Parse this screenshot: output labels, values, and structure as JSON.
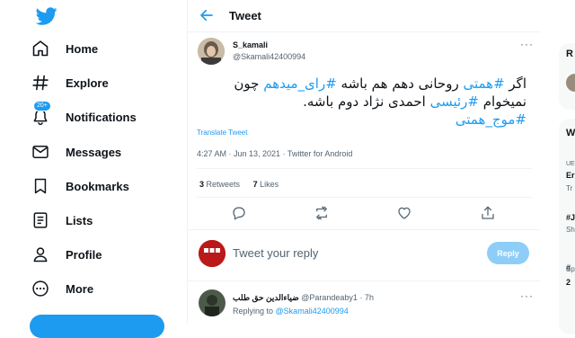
{
  "nav": {
    "items": [
      {
        "label": "Home",
        "icon": "home-icon"
      },
      {
        "label": "Explore",
        "icon": "hashtag-icon"
      },
      {
        "label": "Notifications",
        "icon": "bell-icon",
        "badge": "20+"
      },
      {
        "label": "Messages",
        "icon": "envelope-icon"
      },
      {
        "label": "Bookmarks",
        "icon": "bookmark-icon"
      },
      {
        "label": "Lists",
        "icon": "list-icon"
      },
      {
        "label": "Profile",
        "icon": "person-icon"
      },
      {
        "label": "More",
        "icon": "more-circle-icon"
      }
    ]
  },
  "header": {
    "title": "Tweet"
  },
  "tweet": {
    "display_name": "S_kamali",
    "handle": "@Skamali42400994",
    "text": {
      "line1_pre": "اگر ",
      "tag1": "#همتی",
      "line1_mid": " روحانی دهم هم باشه ",
      "tag2": "#رای_میدهم",
      "line1_post": " چون",
      "line2_pre": "نمیخوام ",
      "tag3": "#رئیسی",
      "line2_post": " احمدی نژاد دوم باشه.",
      "tag4": "#موج_همتی"
    },
    "translate_label": "Translate Tweet",
    "timestamp": "4:27 AM · Jun 13, 2021 · Twitter for Android",
    "retweets_count": "3",
    "retweets_label": "Retweets",
    "likes_count": "7",
    "likes_label": "Likes"
  },
  "reply_box": {
    "placeholder": "Tweet your reply",
    "button_label": "Reply",
    "avatar_text": "BBC NEWS"
  },
  "reply": {
    "display_name": "ضیاءالدین حق طلب",
    "handle": "@Parandeaby1",
    "time": "· 7h",
    "replying_to_label": "Replying to",
    "replying_to_handle": "@Skamali42400994"
  },
  "right": {
    "card1_initial": "R",
    "card2_initial": "W",
    "snippets": [
      "UE",
      "Er",
      "Tr",
      "#J",
      "Sh",
      "#",
      "Sp",
      "2"
    ]
  },
  "colors": {
    "accent": "#1d9bf0",
    "text": "#0f1419",
    "muted": "#536471",
    "border": "#eff3f4"
  }
}
